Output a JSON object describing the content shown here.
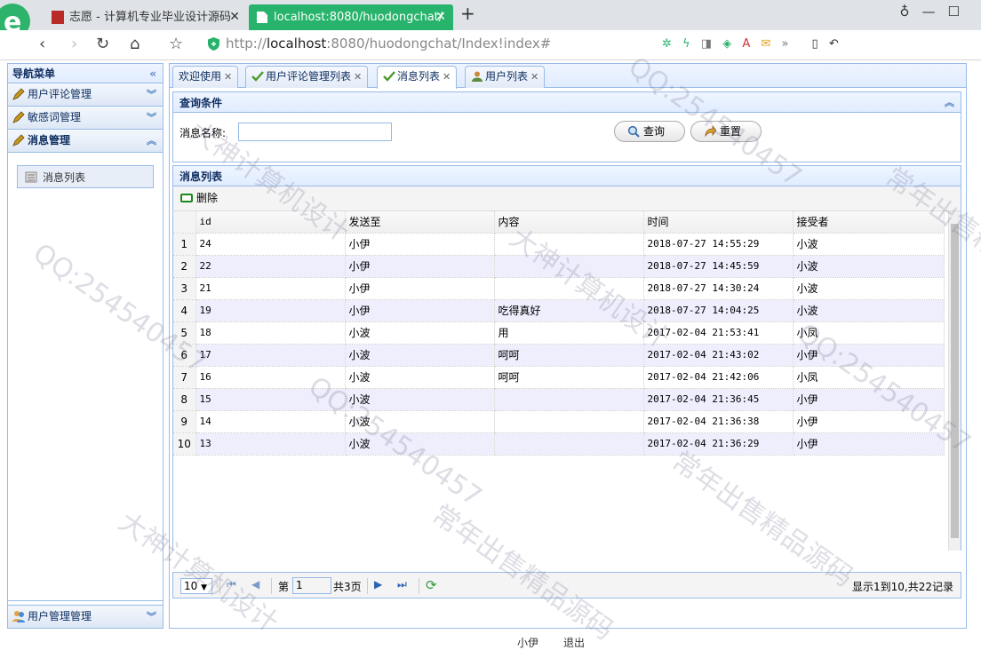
{
  "browser": {
    "tabs": [
      {
        "label": "志愿 - 计算机专业毕业设计源码",
        "active": false
      },
      {
        "label": "localhost:8080/huodongchat/",
        "active": true
      }
    ],
    "url_host": "localhost",
    "url_rest": ":8080/huodongchat/Index!index#",
    "url_prefix": "http://"
  },
  "nav": {
    "title": "导航菜单",
    "sections": [
      {
        "label": "用户评论管理",
        "expanded": false
      },
      {
        "label": "敏感词管理",
        "expanded": false
      },
      {
        "label": "消息管理",
        "expanded": true
      },
      {
        "label": "用户管理管理",
        "expanded": false
      }
    ],
    "active_item": "消息列表"
  },
  "main_tabs": [
    {
      "label": "欢迎使用",
      "icon": "none",
      "active": false
    },
    {
      "label": "用户评论管理列表",
      "icon": "check-icon",
      "active": false
    },
    {
      "label": "消息列表",
      "icon": "check-icon",
      "active": true
    },
    {
      "label": "用户列表",
      "icon": "user-icon",
      "active": false
    }
  ],
  "query": {
    "title": "查询条件",
    "label": "消息名称:",
    "value": "",
    "search_label": "查询",
    "reset_label": "重置"
  },
  "list": {
    "title": "消息列表",
    "delete_label": "删除",
    "columns": [
      "id",
      "发送至",
      "内容",
      "时间",
      "接受者"
    ],
    "rows": [
      {
        "n": "1",
        "id": "24",
        "to": "小伊",
        "content": "",
        "time": "2018-07-27 14:55:29",
        "receiver": "小波"
      },
      {
        "n": "2",
        "id": "22",
        "to": "小伊",
        "content": "",
        "time": "2018-07-27 14:45:59",
        "receiver": "小波"
      },
      {
        "n": "3",
        "id": "21",
        "to": "小伊",
        "content": "",
        "time": "2018-07-27 14:30:24",
        "receiver": "小波"
      },
      {
        "n": "4",
        "id": "19",
        "to": "小伊",
        "content": "吃得真好",
        "time": "2018-07-27 14:04:25",
        "receiver": "小波"
      },
      {
        "n": "5",
        "id": "18",
        "to": "小波",
        "content": "用",
        "time": "2017-02-04 21:53:41",
        "receiver": "小凤"
      },
      {
        "n": "6",
        "id": "17",
        "to": "小波",
        "content": "呵呵",
        "time": "2017-02-04 21:43:02",
        "receiver": "小伊"
      },
      {
        "n": "7",
        "id": "16",
        "to": "小波",
        "content": "呵呵",
        "time": "2017-02-04 21:42:06",
        "receiver": "小凤"
      },
      {
        "n": "8",
        "id": "15",
        "to": "小波",
        "content": "",
        "time": "2017-02-04 21:36:45",
        "receiver": "小伊"
      },
      {
        "n": "9",
        "id": "14",
        "to": "小波",
        "content": "",
        "time": "2017-02-04 21:36:38",
        "receiver": "小伊"
      },
      {
        "n": "10",
        "id": "13",
        "to": "小波",
        "content": "",
        "time": "2017-02-04 21:36:29",
        "receiver": "小伊"
      }
    ]
  },
  "pager": {
    "page_size": "10",
    "page_prefix": "第",
    "page_value": "1",
    "total_pages": "共3页",
    "info": "显示1到10,共22记录"
  },
  "footer": {
    "user": "小伊",
    "logout": "退出"
  },
  "watermarks": [
    "QQ:254540457",
    "大神计算机设计",
    "常年出售精品源码"
  ]
}
